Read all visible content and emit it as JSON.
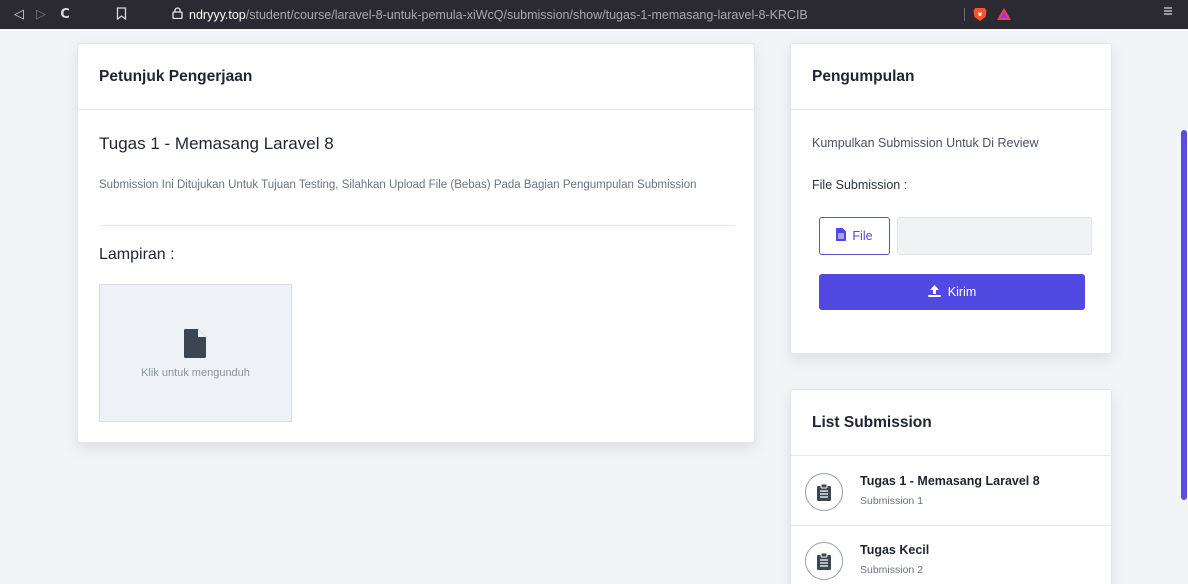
{
  "browser": {
    "url_host": "ndryyy.top",
    "url_path": "/student/course/laravel-8-untuk-pemula-xiWcQ/submission/show/tugas-1-memasang-laravel-8-KRCIB",
    "icons": [
      "back-icon",
      "forward-icon",
      "reload-icon",
      "bookmark-icon",
      "lock-icon",
      "brave-shield-icon",
      "brave-rewards-icon",
      "menu-icon"
    ]
  },
  "instructions": {
    "header": "Petunjuk Pengerjaan",
    "task_title": "Tugas 1 - Memasang Laravel 8",
    "description": "Submission Ini Ditujukan Untuk Tujuan Testing, Silahkan Upload File (Bebas) Pada Bagian Pengumpulan Submission",
    "attachments_title": "Lampiran :",
    "attachment_hint": "Klik untuk mengunduh"
  },
  "submission_form": {
    "header": "Pengumpulan",
    "subtitle": "Kumpulkan Submission Untuk Di Review",
    "file_label": "File Submission :",
    "file_button": "File",
    "submit_button": "Kirim"
  },
  "submission_list": {
    "header": "List Submission",
    "items": [
      {
        "title": "Tugas 1 - Memasang Laravel 8",
        "subtitle": "Submission 1"
      },
      {
        "title": "Tugas Kecil",
        "subtitle": "Submission 2"
      }
    ]
  },
  "colors": {
    "accent": "#5249e3",
    "browser_bar": "#2b2a33",
    "page_bg": "#f3f4f7"
  }
}
